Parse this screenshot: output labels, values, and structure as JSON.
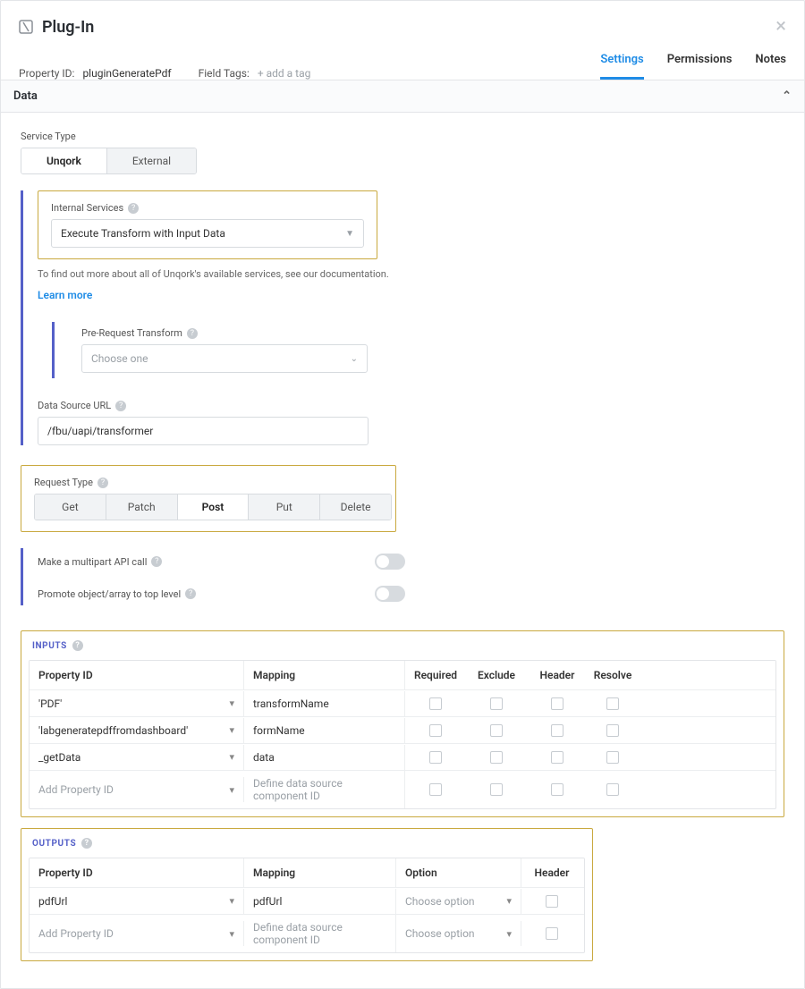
{
  "header": {
    "title": "Plug-In",
    "property_id_label": "Property ID:",
    "property_id_value": "pluginGeneratePdf",
    "field_tags_label": "Field Tags:",
    "add_tag": "+ add a tag",
    "tabs": {
      "settings": "Settings",
      "permissions": "Permissions",
      "notes": "Notes"
    }
  },
  "section": {
    "data": "Data"
  },
  "service_type": {
    "label": "Service Type",
    "unqork": "Unqork",
    "external": "External"
  },
  "internal_services": {
    "label": "Internal Services",
    "value": "Execute Transform with Input Data",
    "note": "To find out more about all of Unqork's available services, see our documentation.",
    "learn": "Learn more"
  },
  "pre_request": {
    "label": "Pre-Request Transform",
    "placeholder": "Choose one"
  },
  "data_source": {
    "label": "Data Source URL",
    "value": "/fbu/uapi/transformer"
  },
  "request_type": {
    "label": "Request Type",
    "options": {
      "get": "Get",
      "patch": "Patch",
      "post": "Post",
      "put": "Put",
      "delete": "Delete"
    }
  },
  "switches": {
    "multipart": "Make a multipart API call",
    "promote": "Promote object/array to top level"
  },
  "inputs": {
    "title": "INPUTS",
    "cols": {
      "prop": "Property ID",
      "map": "Mapping",
      "req": "Required",
      "exc": "Exclude",
      "hdr": "Header",
      "res": "Resolve"
    },
    "rows": [
      {
        "prop": "'PDF'",
        "map": "transformName"
      },
      {
        "prop": "'labgeneratepdffromdashboard'",
        "map": "formName"
      },
      {
        "prop": "_getData",
        "map": "data"
      }
    ],
    "add_prop": "Add Property ID",
    "define_map": "Define data source component ID"
  },
  "outputs": {
    "title": "OUTPUTS",
    "cols": {
      "prop": "Property ID",
      "map": "Mapping",
      "opt": "Option",
      "hdr": "Header"
    },
    "rows": [
      {
        "prop": "pdfUrl",
        "map": "pdfUrl",
        "opt": "Choose option"
      }
    ],
    "add_prop": "Add Property ID",
    "define_map": "Define data source component ID",
    "choose_opt": "Choose option"
  }
}
